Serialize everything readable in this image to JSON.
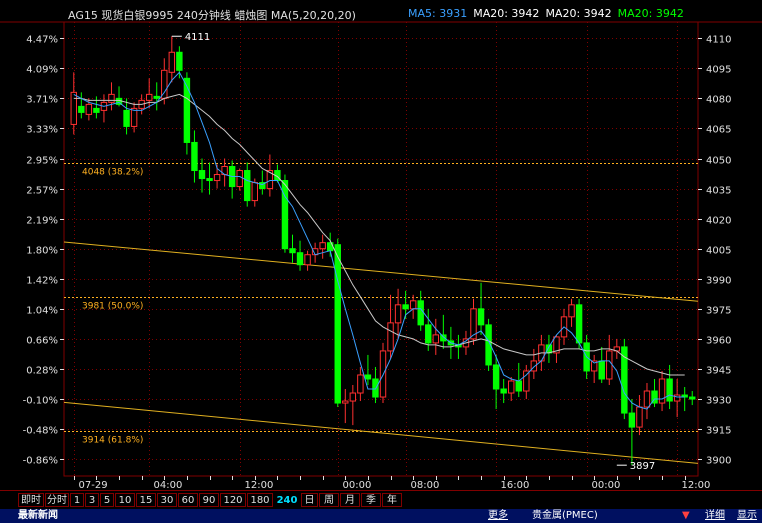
{
  "header": {
    "instrument": "AG15 现货白银9995 240分钟线 蜡烛图 MA(5,20,20,20)",
    "ma_items": [
      {
        "label": "MA5:",
        "value": "3931",
        "color": "#3aa0ff"
      },
      {
        "label": "MA20:",
        "value": "3942",
        "color": "#ffffff"
      },
      {
        "label": "MA20:",
        "value": "3942",
        "color": "#ffffff"
      },
      {
        "label": "MA20:",
        "value": "3942",
        "color": "#00ff00"
      }
    ]
  },
  "chart_data": {
    "type": "candlestick",
    "price_axis": {
      "ticks": [
        4110,
        4095,
        4080,
        4065,
        4050,
        4035,
        4020,
        4005,
        3990,
        3975,
        3960,
        3945,
        3930,
        3915,
        3900
      ],
      "range": [
        3891.6,
        4118.1
      ]
    },
    "percent_axis": {
      "ticks": [
        "4.47%",
        "4.09%",
        "3.71%",
        "3.33%",
        "2.95%",
        "2.57%",
        "2.19%",
        "1.80%",
        "1.42%",
        "1.04%",
        "0.66%",
        "0.28%",
        "-0.10%",
        "-0.48%",
        "-0.86%"
      ]
    },
    "time_axis": {
      "labels": [
        {
          "text": "07-29",
          "index": 0
        },
        {
          "text": "04:00",
          "index": 10
        },
        {
          "text": "12:00",
          "index": 22
        },
        {
          "text": "00:00",
          "index": 35
        },
        {
          "text": "08:00",
          "index": 44
        },
        {
          "text": "16:00",
          "index": 56
        },
        {
          "text": "00:00",
          "index": 68
        },
        {
          "text": "12:00",
          "index": 80
        },
        {
          "text": "20:00",
          "index": 92
        }
      ]
    },
    "candles": [
      {
        "o": 4067,
        "h": 4093,
        "l": 4062,
        "c": 4083
      },
      {
        "o": 4076,
        "h": 4083,
        "l": 4070,
        "c": 4073
      },
      {
        "o": 4072,
        "h": 4080,
        "l": 4069,
        "c": 4077
      },
      {
        "o": 4075,
        "h": 4081,
        "l": 4070,
        "c": 4073
      },
      {
        "o": 4074,
        "h": 4082,
        "l": 4068,
        "c": 4078
      },
      {
        "o": 4078,
        "h": 4088,
        "l": 4074,
        "c": 4082
      },
      {
        "o": 4080,
        "h": 4086,
        "l": 4076,
        "c": 4077
      },
      {
        "o": 4074,
        "h": 4080,
        "l": 4062,
        "c": 4066
      },
      {
        "o": 4066,
        "h": 4078,
        "l": 4063,
        "c": 4075
      },
      {
        "o": 4075,
        "h": 4082,
        "l": 4072,
        "c": 4079
      },
      {
        "o": 4079,
        "h": 4090,
        "l": 4075,
        "c": 4082
      },
      {
        "o": 4081,
        "h": 4088,
        "l": 4074,
        "c": 4080
      },
      {
        "o": 4080,
        "h": 4100,
        "l": 4077,
        "c": 4094
      },
      {
        "o": 4093,
        "h": 4111,
        "l": 4088,
        "c": 4103
      },
      {
        "o": 4103,
        "h": 4106,
        "l": 4090,
        "c": 4094
      },
      {
        "o": 4090,
        "h": 4093,
        "l": 4052,
        "c": 4058
      },
      {
        "o": 4058,
        "h": 4064,
        "l": 4038,
        "c": 4044
      },
      {
        "o": 4044,
        "h": 4050,
        "l": 4033,
        "c": 4040
      },
      {
        "o": 4040,
        "h": 4048,
        "l": 4032,
        "c": 4039
      },
      {
        "o": 4039,
        "h": 4047,
        "l": 4035,
        "c": 4042
      },
      {
        "o": 4042,
        "h": 4050,
        "l": 4036,
        "c": 4046
      },
      {
        "o": 4046,
        "h": 4049,
        "l": 4030,
        "c": 4036
      },
      {
        "o": 4036,
        "h": 4045,
        "l": 4034,
        "c": 4044
      },
      {
        "o": 4044,
        "h": 4048,
        "l": 4026,
        "c": 4029
      },
      {
        "o": 4029,
        "h": 4040,
        "l": 4026,
        "c": 4038
      },
      {
        "o": 4038,
        "h": 4044,
        "l": 4032,
        "c": 4035
      },
      {
        "o": 4035,
        "h": 4052,
        "l": 4031,
        "c": 4044
      },
      {
        "o": 4044,
        "h": 4047,
        "l": 4038,
        "c": 4039
      },
      {
        "o": 4039,
        "h": 4042,
        "l": 4003,
        "c": 4005
      },
      {
        "o": 4005,
        "h": 4012,
        "l": 3998,
        "c": 4003
      },
      {
        "o": 4003,
        "h": 4009,
        "l": 3994,
        "c": 3997
      },
      {
        "o": 3997,
        "h": 4004,
        "l": 3994,
        "c": 4002
      },
      {
        "o": 4002,
        "h": 4008,
        "l": 3998,
        "c": 4005
      },
      {
        "o": 4005,
        "h": 4012,
        "l": 4000,
        "c": 4008
      },
      {
        "o": 4008,
        "h": 4013,
        "l": 4001,
        "c": 4004
      },
      {
        "o": 4007,
        "h": 4010,
        "l": 3926,
        "c": 3928
      },
      {
        "o": 3928,
        "h": 3935,
        "l": 3918,
        "c": 3929
      },
      {
        "o": 3929,
        "h": 3937,
        "l": 3917,
        "c": 3933
      },
      {
        "o": 3933,
        "h": 3946,
        "l": 3929,
        "c": 3942
      },
      {
        "o": 3942,
        "h": 3952,
        "l": 3937,
        "c": 3940
      },
      {
        "o": 3940,
        "h": 3946,
        "l": 3928,
        "c": 3931
      },
      {
        "o": 3931,
        "h": 3958,
        "l": 3928,
        "c": 3954
      },
      {
        "o": 3954,
        "h": 3982,
        "l": 3950,
        "c": 3968
      },
      {
        "o": 3968,
        "h": 3985,
        "l": 3960,
        "c": 3977
      },
      {
        "o": 3977,
        "h": 3984,
        "l": 3970,
        "c": 3975
      },
      {
        "o": 3975,
        "h": 3982,
        "l": 3970,
        "c": 3979
      },
      {
        "o": 3979,
        "h": 3984,
        "l": 3964,
        "c": 3967
      },
      {
        "o": 3967,
        "h": 3975,
        "l": 3954,
        "c": 3958
      },
      {
        "o": 3958,
        "h": 3970,
        "l": 3952,
        "c": 3962
      },
      {
        "o": 3962,
        "h": 3972,
        "l": 3955,
        "c": 3959
      },
      {
        "o": 3959,
        "h": 3966,
        "l": 3950,
        "c": 3957
      },
      {
        "o": 3957,
        "h": 3962,
        "l": 3950,
        "c": 3956
      },
      {
        "o": 3956,
        "h": 3964,
        "l": 3952,
        "c": 3960
      },
      {
        "o": 3960,
        "h": 3980,
        "l": 3957,
        "c": 3975
      },
      {
        "o": 3975,
        "h": 3988,
        "l": 3962,
        "c": 3967
      },
      {
        "o": 3967,
        "h": 3970,
        "l": 3944,
        "c": 3947
      },
      {
        "o": 3947,
        "h": 3952,
        "l": 3925,
        "c": 3935
      },
      {
        "o": 3935,
        "h": 3940,
        "l": 3928,
        "c": 3933
      },
      {
        "o": 3933,
        "h": 3941,
        "l": 3929,
        "c": 3939
      },
      {
        "o": 3939,
        "h": 3948,
        "l": 3931,
        "c": 3934
      },
      {
        "o": 3934,
        "h": 3947,
        "l": 3930,
        "c": 3944
      },
      {
        "o": 3944,
        "h": 3955,
        "l": 3940,
        "c": 3949
      },
      {
        "o": 3949,
        "h": 3962,
        "l": 3944,
        "c": 3957
      },
      {
        "o": 3957,
        "h": 3962,
        "l": 3948,
        "c": 3953
      },
      {
        "o": 3953,
        "h": 3962,
        "l": 3948,
        "c": 3961
      },
      {
        "o": 3961,
        "h": 3975,
        "l": 3957,
        "c": 3971
      },
      {
        "o": 3971,
        "h": 3980,
        "l": 3966,
        "c": 3977
      },
      {
        "o": 3977,
        "h": 3980,
        "l": 3955,
        "c": 3958
      },
      {
        "o": 3958,
        "h": 3962,
        "l": 3940,
        "c": 3944
      },
      {
        "o": 3944,
        "h": 3952,
        "l": 3938,
        "c": 3949
      },
      {
        "o": 3949,
        "h": 3956,
        "l": 3938,
        "c": 3940
      },
      {
        "o": 3940,
        "h": 3962,
        "l": 3937,
        "c": 3954
      },
      {
        "o": 3954,
        "h": 3960,
        "l": 3950,
        "c": 3956
      },
      {
        "o": 3956,
        "h": 3960,
        "l": 3920,
        "c": 3923
      },
      {
        "o": 3923,
        "h": 3930,
        "l": 3897,
        "c": 3916
      },
      {
        "o": 3916,
        "h": 3932,
        "l": 3912,
        "c": 3926
      },
      {
        "o": 3926,
        "h": 3938,
        "l": 3920,
        "c": 3934
      },
      {
        "o": 3934,
        "h": 3940,
        "l": 3926,
        "c": 3928
      },
      {
        "o": 3928,
        "h": 3944,
        "l": 3924,
        "c": 3940
      },
      {
        "o": 3940,
        "h": 3947,
        "l": 3925,
        "c": 3929
      },
      {
        "o": 3929,
        "h": 3940,
        "l": 3921,
        "c": 3932
      },
      {
        "o": 3932,
        "h": 3936,
        "l": 3924,
        "c": 3931
      },
      {
        "o": 3931,
        "h": 3934,
        "l": 3927,
        "c": 3930
      }
    ],
    "ma5": [
      4082,
      4080,
      4078,
      4077,
      4076,
      4077,
      4078,
      4075,
      4074,
      4074,
      4076,
      4078,
      4083,
      4089,
      4093,
      4086,
      4078,
      4068,
      4058,
      4045,
      4042,
      4041,
      4041,
      4039,
      4038,
      4037,
      4039,
      4039,
      4031,
      4026,
      4018,
      4010,
      4002,
      4003,
      4004,
      3989,
      3975,
      3962,
      3948,
      3935,
      3935,
      3942,
      3950,
      3960,
      3972,
      3975,
      3975,
      3970,
      3965,
      3961,
      3958,
      3957,
      3959,
      3962,
      3964,
      3959,
      3951,
      3942,
      3940,
      3939,
      3942,
      3946,
      3949,
      3956,
      3962,
      3966,
      3963,
      3958,
      3951,
      3948,
      3949,
      3949,
      3944,
      3933,
      3928,
      3926,
      3925,
      3930,
      3930,
      3932,
      3931,
      3931
    ],
    "ma20": [
      4080,
      4080,
      4079,
      4079,
      4079,
      4079,
      4079,
      4078,
      4077,
      4077,
      4078,
      4078,
      4080,
      4081,
      4082,
      4080,
      4077,
      4074,
      4071,
      4067,
      4064,
      4060,
      4057,
      4053,
      4049,
      4045,
      4043,
      4041,
      4037,
      4032,
      4027,
      4023,
      4018,
      4013,
      4009,
      4001,
      3994,
      3987,
      3981,
      3975,
      3969,
      3966,
      3964,
      3962,
      3961,
      3960,
      3958,
      3957,
      3957,
      3956,
      3956,
      3957,
      3958,
      3959,
      3960,
      3959,
      3957,
      3955,
      3954,
      3953,
      3952,
      3952,
      3953,
      3953,
      3954,
      3955,
      3955,
      3955,
      3954,
      3954,
      3955,
      3955,
      3954,
      3951,
      3949,
      3947,
      3945,
      3944,
      3943,
      3942,
      3942,
      3942
    ],
    "levels": [
      {
        "value": 4048,
        "label": "4048 (38.2%)"
      },
      {
        "value": 3981,
        "label": "3981 (50.0%)"
      },
      {
        "value": 3914,
        "label": "3914 (61.8%)"
      }
    ],
    "trendlines": [
      {
        "from": [
          0,
          4008
        ],
        "to": [
          92,
          3976
        ]
      },
      {
        "from": [
          0,
          3928
        ],
        "to": [
          92,
          3895
        ]
      }
    ],
    "annotations": [
      {
        "text": "4111",
        "index": 13,
        "value": 4111
      },
      {
        "text": "3897",
        "index": 72,
        "value": 3897
      }
    ]
  },
  "period_bar": {
    "buttons": [
      "即时",
      "分时",
      "1",
      "3",
      "5",
      "10",
      "15",
      "30",
      "60",
      "90",
      "120",
      "180",
      "240",
      "日",
      "周",
      "月",
      "季",
      "年"
    ],
    "active": "240"
  },
  "status_bar": {
    "left": "最新新闻",
    "more": "更多",
    "market": "贵金属(PMEC)",
    "detail": "详细",
    "show": "显示"
  },
  "colors": {
    "up": "#ff3030",
    "down": "#00ff00",
    "grid": "#800000",
    "fib": "#ffb020",
    "trend": "#e0b020",
    "ma5": "#3aa0ff",
    "ma20": "#c8c8c8",
    "axis_text": "#e0e0e0"
  }
}
